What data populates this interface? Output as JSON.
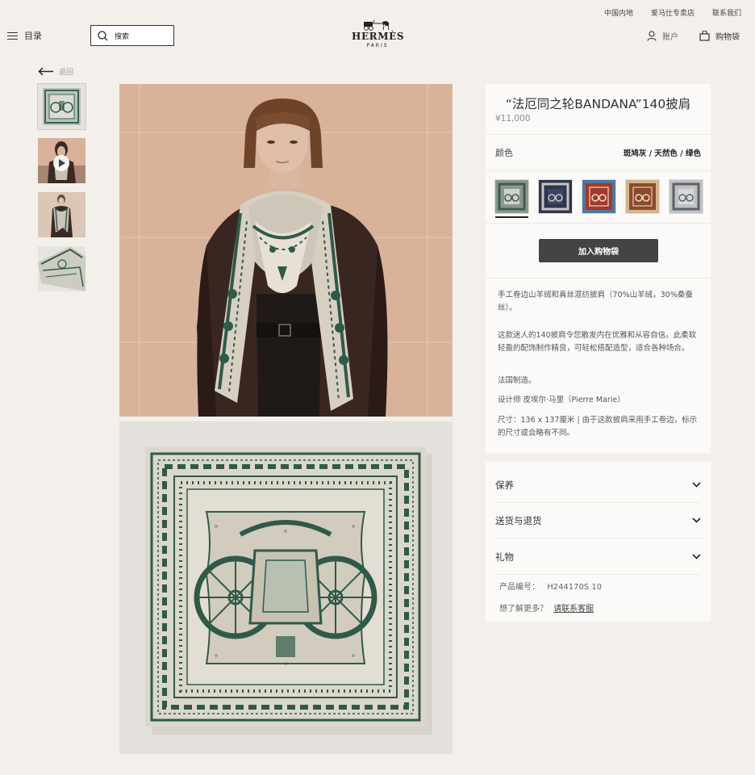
{
  "header": {
    "util_links": [
      "中国内地",
      "爱马仕专卖店",
      "联系我们"
    ],
    "menu_label": "目录",
    "search_label": "搜索",
    "logo_text": "HERMÈS",
    "logo_sub": "PARIS",
    "account_label": "账户",
    "bag_label": "购物袋"
  },
  "back_label": "返回",
  "product": {
    "title": "“法厄同之轮BANDANA”140披肩",
    "price": "¥11,000",
    "color_label": "颜色",
    "color_value": "斑鸠灰 / 天然色 / 绿色",
    "add_to_bag": "加入购物袋",
    "desc1": "手工卷边山羊绒和真丝混纺披肩（70%山羊绒，30%桑蚕丝）。",
    "desc2": "这款迷人的140披肩令您散发内在优雅和从容自信。此柔软轻盈的配饰制作精良，可轻松搭配造型，适合各种场合。",
    "desc3": "法国制造。",
    "desc4": "设计师 皮埃尔·马里（Pierre Marie）",
    "desc5": "尺寸：136 x 137厘米 | 由于这款披肩采用手工卷边，标示的尺寸或会略有不同。"
  },
  "swatches": [
    {
      "name": "grey-green",
      "bg": "#8d978c",
      "ink": "#3d5c4f"
    },
    {
      "name": "navy",
      "bg": "#2e3550",
      "ink": "#c9c4bc"
    },
    {
      "name": "red-blue",
      "bg": "#a13a2a",
      "ink": "#4f77a0"
    },
    {
      "name": "brown",
      "bg": "#8a4a2e",
      "ink": "#d6b48e"
    },
    {
      "name": "light-grey",
      "bg": "#bfc2c4",
      "ink": "#5e6166"
    }
  ],
  "accordion": {
    "care": "保养",
    "shipping": "送货与退货",
    "gift": "礼物",
    "ref_label": "产品编号：",
    "ref_value": "H244170S 10",
    "more_label": "想了解更多？",
    "contact_link": "请联系客服"
  },
  "colors": {
    "background": "#f3f0ec",
    "panel": "#fbfaf8",
    "button": "#444444",
    "scarf_green": "#2f5a4a"
  }
}
